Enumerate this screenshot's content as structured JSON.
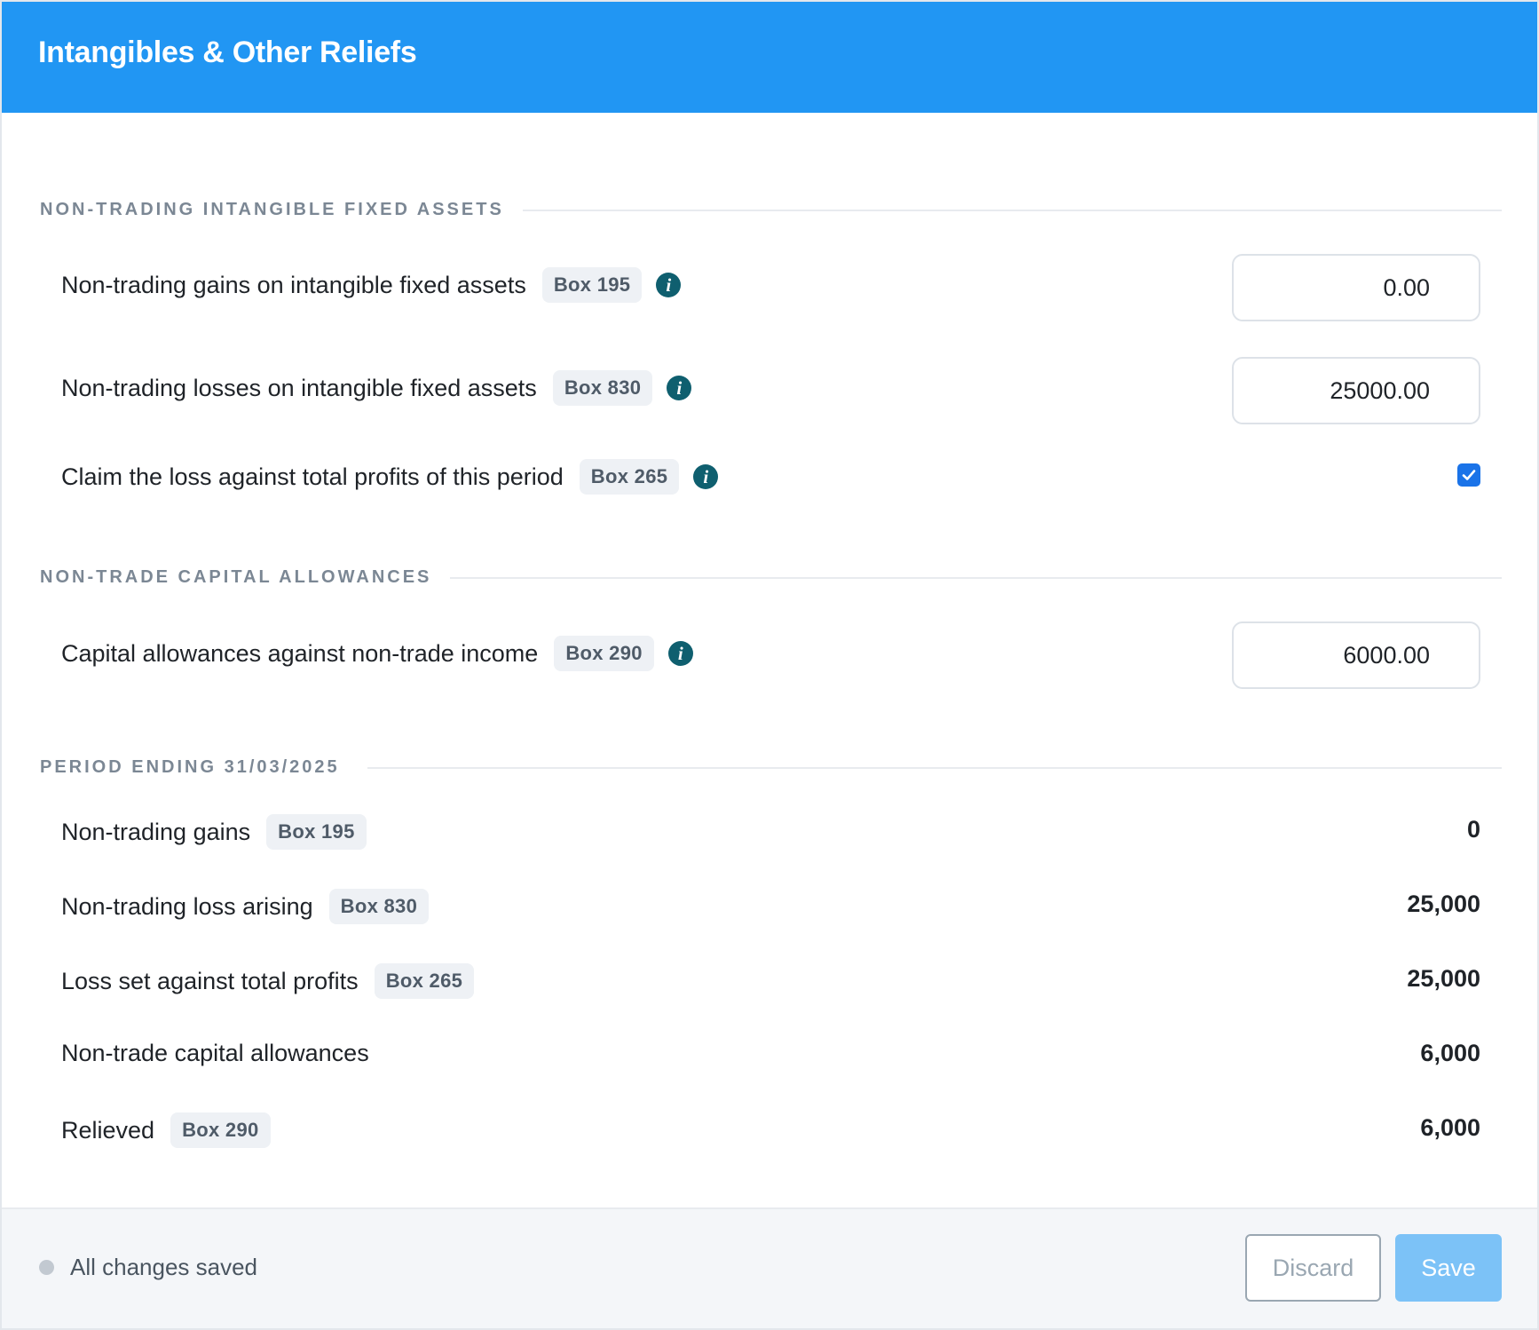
{
  "header": {
    "title": "Intangibles & Other Reliefs"
  },
  "sections": {
    "intangibles": {
      "title": "NON-TRADING INTANGIBLE FIXED ASSETS",
      "gains": {
        "label": "Non-trading gains on intangible fixed assets",
        "badge": "Box 195",
        "value": "0.00"
      },
      "losses": {
        "label": "Non-trading losses on intangible fixed assets",
        "badge": "Box 830",
        "value": "25000.00"
      },
      "claim": {
        "label": "Claim the loss against total profits of this period",
        "badge": "Box 265",
        "checked": true
      }
    },
    "capital": {
      "title": "NON-TRADE CAPITAL ALLOWANCES",
      "allowances": {
        "label": "Capital allowances against non-trade income",
        "badge": "Box 290",
        "value": "6000.00"
      }
    },
    "period": {
      "title": "PERIOD ENDING 31/03/2025",
      "rows": [
        {
          "label": "Non-trading gains",
          "badge": "Box 195",
          "value": "0"
        },
        {
          "label": "Non-trading loss arising",
          "badge": "Box 830",
          "value": "25,000"
        },
        {
          "label": "Loss set against total profits",
          "badge": "Box 265",
          "value": "25,000"
        },
        {
          "label": "Non-trade capital allowances",
          "badge": "",
          "value": "6,000"
        },
        {
          "label": "Relieved",
          "badge": "Box 290",
          "value": "6,000"
        }
      ]
    }
  },
  "footer": {
    "status": "All changes saved",
    "discard_label": "Discard",
    "save_label": "Save"
  },
  "colors": {
    "header": "#2196f3",
    "info_icon": "#0f5f6f",
    "checkbox": "#1a73e8",
    "save_button": "#7cc2f7"
  },
  "icons": {
    "info": "info-icon",
    "checkbox": "checkmark-icon",
    "status": "status-dot-icon"
  }
}
